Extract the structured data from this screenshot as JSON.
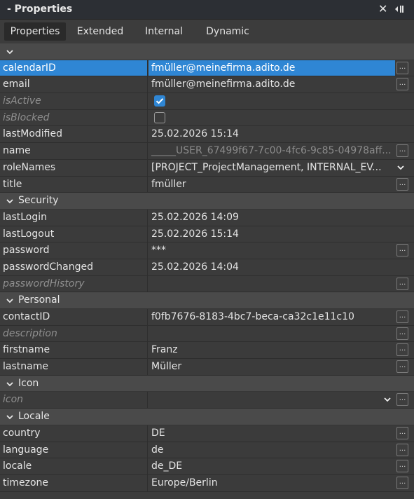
{
  "window": {
    "title": "- Properties"
  },
  "tabs": [
    "Properties",
    "Extended",
    "Internal",
    "Dynamic"
  ],
  "active_tab": "Properties",
  "rows": [
    {
      "kind": "section",
      "label": ""
    },
    {
      "kind": "prop",
      "name": "calendarID",
      "value": "fmüller@meinefirma.adito.de",
      "selected": true,
      "button": true
    },
    {
      "kind": "prop",
      "name": "email",
      "value": "fmüller@meinefirma.adito.de",
      "button": true
    },
    {
      "kind": "prop",
      "name": "isActive",
      "dim": true,
      "checkbox": true,
      "checked": true
    },
    {
      "kind": "prop",
      "name": "isBlocked",
      "dim": true,
      "checkbox": true,
      "checked": false
    },
    {
      "kind": "prop",
      "name": "lastModified",
      "value": "25.02.2026 15:14"
    },
    {
      "kind": "prop",
      "name": "name",
      "value": "_____USER_67499f67-7c00-4fc6-9c85-04978aff...",
      "value_dim": true,
      "button": true
    },
    {
      "kind": "prop",
      "name": "roleNames",
      "value": "[PROJECT_ProjectManagement, INTERNAL_EV...",
      "dropdown": true
    },
    {
      "kind": "prop",
      "name": "title",
      "value": "fmüller",
      "button": true
    },
    {
      "kind": "section",
      "label": "Security"
    },
    {
      "kind": "prop",
      "name": "lastLogin",
      "value": "25.02.2026 14:09"
    },
    {
      "kind": "prop",
      "name": "lastLogout",
      "value": "25.02.2026 15:14"
    },
    {
      "kind": "prop",
      "name": "password",
      "value": "***",
      "button": true
    },
    {
      "kind": "prop",
      "name": "passwordChanged",
      "value": "25.02.2026 14:04"
    },
    {
      "kind": "prop",
      "name": "passwordHistory",
      "dim": true,
      "value": "",
      "button": true
    },
    {
      "kind": "section",
      "label": "Personal"
    },
    {
      "kind": "prop",
      "name": "contactID",
      "value": "f0fb7676-8183-4bc7-beca-ca32c1e11c10",
      "button": true
    },
    {
      "kind": "prop",
      "name": "description",
      "dim": true,
      "value": "",
      "button": true
    },
    {
      "kind": "prop",
      "name": "firstname",
      "value": "Franz",
      "button": true
    },
    {
      "kind": "prop",
      "name": "lastname",
      "value": "Müller",
      "button": true
    },
    {
      "kind": "section",
      "label": "Icon"
    },
    {
      "kind": "prop",
      "name": "icon",
      "dim": true,
      "value": "",
      "dropdown": true,
      "dropdown_with_button": true,
      "button": true
    },
    {
      "kind": "section",
      "label": "Locale"
    },
    {
      "kind": "prop",
      "name": "country",
      "value": "DE",
      "button": true
    },
    {
      "kind": "prop",
      "name": "language",
      "value": "de",
      "button": true
    },
    {
      "kind": "prop",
      "name": "locale",
      "value": "de_DE",
      "button": true
    },
    {
      "kind": "prop",
      "name": "timezone",
      "value": "Europe/Berlin",
      "button": true
    }
  ],
  "labels": {
    "ellipsis": "...",
    "close": "✕"
  },
  "colors": {
    "selection": "#2f86d4",
    "section_bg": "#4a4a4a",
    "row_bg": "#3b3b3b",
    "title_bg": "#2c2f34"
  },
  "icons": {
    "close": "close-icon",
    "dock": "dock-icon",
    "section_toggle": "chevron-down-icon",
    "dropdown": "chevron-down-icon",
    "check": "check-icon"
  }
}
